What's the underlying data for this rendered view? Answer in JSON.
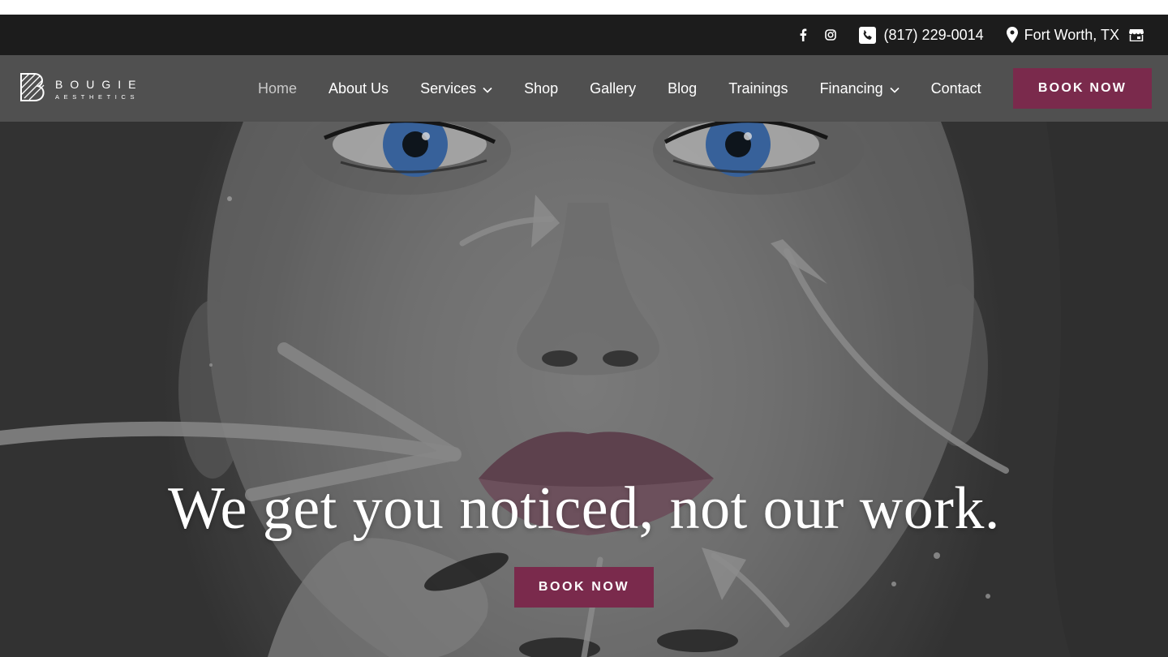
{
  "topbar": {
    "phone": "(817) 229-0014",
    "location": "Fort Worth, TX",
    "icons": [
      "facebook-icon",
      "instagram-icon",
      "phone-icon",
      "map-pin-icon",
      "store-icon"
    ]
  },
  "brand": {
    "name": "BOUGIE",
    "tagline": "AESTHETICS"
  },
  "nav": {
    "items": [
      {
        "label": "Home",
        "active": true
      },
      {
        "label": "About Us"
      },
      {
        "label": "Services",
        "dropdown": true
      },
      {
        "label": "Shop"
      },
      {
        "label": "Gallery"
      },
      {
        "label": "Blog"
      },
      {
        "label": "Trainings"
      },
      {
        "label": "Financing",
        "dropdown": true
      },
      {
        "label": "Contact"
      }
    ],
    "cta": "BOOK NOW"
  },
  "hero": {
    "headline": "We get you noticed, not our work.",
    "cta": "BOOK NOW"
  },
  "colors": {
    "accent": "#7a2a4c",
    "topbar": "#1c1c1c",
    "navbar": "#505050",
    "eye": "#3f6fb0"
  }
}
